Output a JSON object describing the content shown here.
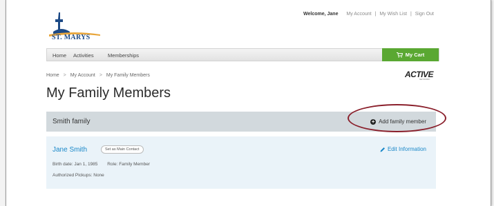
{
  "header": {
    "logo_text": "ST. MARYS",
    "welcome": "Welcome, Jane",
    "links": [
      "My Account",
      "My Wish List",
      "Sign Out"
    ],
    "link_separator": "|"
  },
  "nav": {
    "items": [
      "Home",
      "Activities",
      "Memberships"
    ],
    "cart_label": "My Cart",
    "cart_color": "#5aa832"
  },
  "breadcrumb": {
    "items": [
      "Home",
      "My Account",
      "My Family Members"
    ],
    "separator": ">"
  },
  "partner_logo": {
    "text": "ACTIVE",
    "subtext": "NETWORK"
  },
  "page": {
    "title": "My Family Members"
  },
  "family": {
    "name": "Smith family",
    "add_label": "Add family member",
    "members": [
      {
        "name": "Jane Smith",
        "badge": "Set as Main Contact",
        "edit_label": "Edit Information",
        "birth_date": "Birth date: Jan 1, 1985",
        "role": "Role: Family Member",
        "pickups": "Authorized Pickups: None"
      }
    ]
  },
  "colors": {
    "link_blue": "#1a88c9",
    "highlight_ring": "#8a1f2b"
  }
}
